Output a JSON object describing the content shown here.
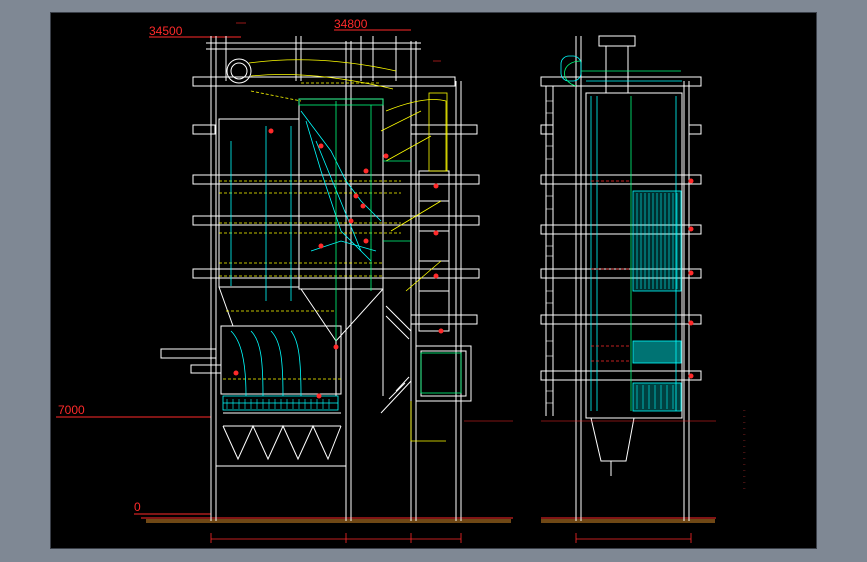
{
  "colors": {
    "background": "#7f8894",
    "canvas": "#000000",
    "structure": "#ffffff",
    "pipes": "#ffff00",
    "tubes": "#00ffff",
    "duct": "#00ff7f",
    "dimension": "#ff2a2a"
  },
  "elevations": {
    "top_left": "34500",
    "top_right": "34800",
    "mid": "7000",
    "ground": "0"
  },
  "legend": {
    "lines": [
      "—",
      "—",
      "—",
      "—",
      "—",
      "—",
      "—",
      "—",
      "—",
      "—",
      "—",
      "—",
      "—",
      "—"
    ]
  }
}
